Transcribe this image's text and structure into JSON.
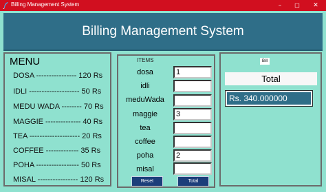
{
  "window": {
    "title": "Billing Management System",
    "controls": {
      "minimize": "–",
      "maximize": "□",
      "close": "✕"
    }
  },
  "header": {
    "title": "Billing Management System"
  },
  "menu": {
    "heading": "MENU",
    "lines": [
      "DOSA ---------------- 120 Rs",
      "IDLI -------------------- 50 Rs",
      "MEDU WADA -------- 70 Rs",
      "MAGGIE -------------- 40 Rs",
      "TEA -------------------- 20 Rs",
      "COFFEE ------------- 35 Rs",
      "POHA ----------------- 50 Rs",
      "MISAL ---------------- 120 Rs"
    ]
  },
  "items": {
    "heading": "ITEMS",
    "rows": [
      {
        "label": "dosa",
        "value": "1"
      },
      {
        "label": "idli",
        "value": ""
      },
      {
        "label": "meduWada",
        "value": ""
      },
      {
        "label": "maggie",
        "value": "3"
      },
      {
        "label": "tea",
        "value": ""
      },
      {
        "label": "coffee",
        "value": ""
      },
      {
        "label": "poha",
        "value": "2"
      },
      {
        "label": "misal",
        "value": ""
      }
    ],
    "reset_label": "Reset",
    "total_label": "Total"
  },
  "bill": {
    "badge": "Bill",
    "total_heading": "Total",
    "total_value": "Rs. 340.000000"
  }
}
